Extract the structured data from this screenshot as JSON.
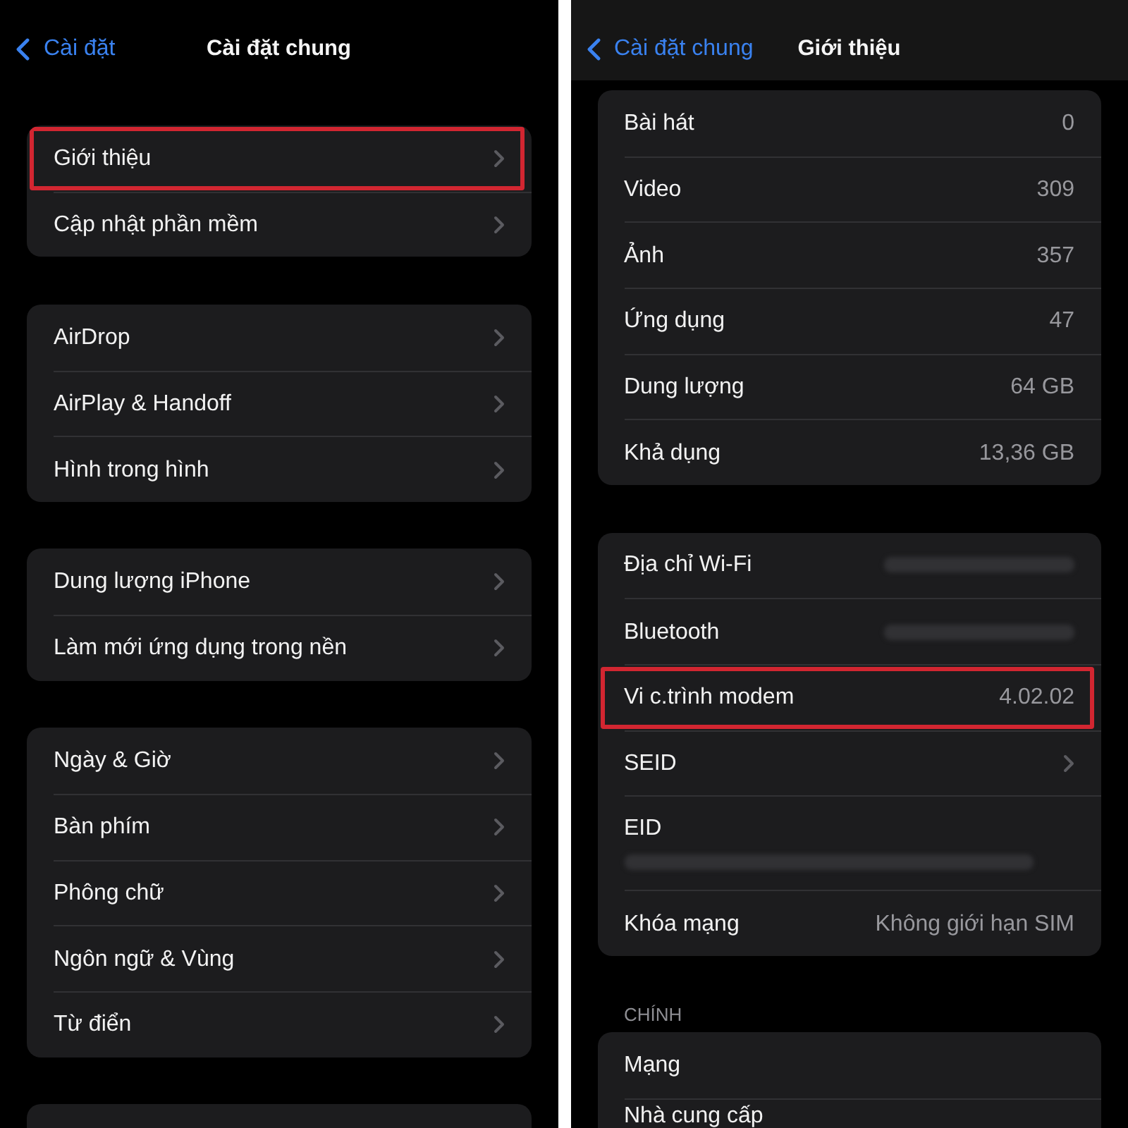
{
  "screens": [
    {
      "nav_bar": {
        "back_label": "Cài đặt",
        "title": "Cài đặt chung",
        "translucent": false
      },
      "groups": [
        {
          "rows": [
            {
              "kind": "link",
              "label": "Giới thiệu",
              "highlighted": true
            },
            {
              "kind": "link",
              "label": "Cập nhật phần mềm",
              "highlighted": false
            }
          ]
        },
        {
          "rows": [
            {
              "kind": "link",
              "label": "AirDrop",
              "highlighted": false
            },
            {
              "kind": "link",
              "label": "AirPlay & Handoff",
              "highlighted": false
            },
            {
              "kind": "link",
              "label": "Hình trong hình",
              "highlighted": false
            }
          ]
        },
        {
          "rows": [
            {
              "kind": "link",
              "label": "Dung lượng iPhone",
              "highlighted": false
            },
            {
              "kind": "link",
              "label": "Làm mới ứng dụng trong nền",
              "highlighted": false
            }
          ]
        },
        {
          "rows": [
            {
              "kind": "link",
              "label": "Ngày & Giờ",
              "highlighted": false
            },
            {
              "kind": "link",
              "label": "Bàn phím",
              "highlighted": false
            },
            {
              "kind": "link",
              "label": "Phông chữ",
              "highlighted": false
            },
            {
              "kind": "link",
              "label": "Ngôn ngữ & Vùng",
              "highlighted": false
            },
            {
              "kind": "link",
              "label": "Từ điển",
              "highlighted": false
            }
          ]
        },
        {
          "cut_off": true
        }
      ]
    },
    {
      "nav_bar": {
        "back_label": "Cài đặt chung",
        "title": "Giới thiệu",
        "translucent": true
      },
      "groups": [
        {
          "rows": [
            {
              "kind": "value",
              "label": "Bài hát",
              "value": "0",
              "highlighted": false
            },
            {
              "kind": "value",
              "label": "Video",
              "value": "309",
              "highlighted": false
            },
            {
              "kind": "value",
              "label": "Ảnh",
              "value": "357",
              "highlighted": false
            },
            {
              "kind": "value",
              "label": "Ứng dụng",
              "value": "47",
              "highlighted": false
            },
            {
              "kind": "value",
              "label": "Dung lượng",
              "value": "64 GB",
              "highlighted": false
            },
            {
              "kind": "value",
              "label": "Khả dụng",
              "value": "13,36 GB",
              "highlighted": false
            }
          ]
        },
        {
          "rows": [
            {
              "kind": "hidden",
              "label": "Địa chỉ Wi-Fi",
              "highlighted": false
            },
            {
              "kind": "hidden",
              "label": "Bluetooth",
              "highlighted": false
            },
            {
              "kind": "value",
              "label": "Vi c.trình modem",
              "value": "4.02.02",
              "highlighted": true
            },
            {
              "kind": "link",
              "label": "SEID",
              "highlighted": false
            },
            {
              "kind": "hidden_detail",
              "label": "EID",
              "highlighted": false
            },
            {
              "kind": "value",
              "label": "Khóa mạng",
              "value": "Không giới hạn SIM",
              "highlighted": false
            }
          ]
        },
        {
          "header": "CHÍNH",
          "rows": [
            {
              "kind": "plain",
              "label": "Mạng",
              "highlighted": false
            },
            {
              "kind": "plain",
              "label": "Nhà cung cấp",
              "highlighted": false
            }
          ]
        }
      ]
    }
  ]
}
